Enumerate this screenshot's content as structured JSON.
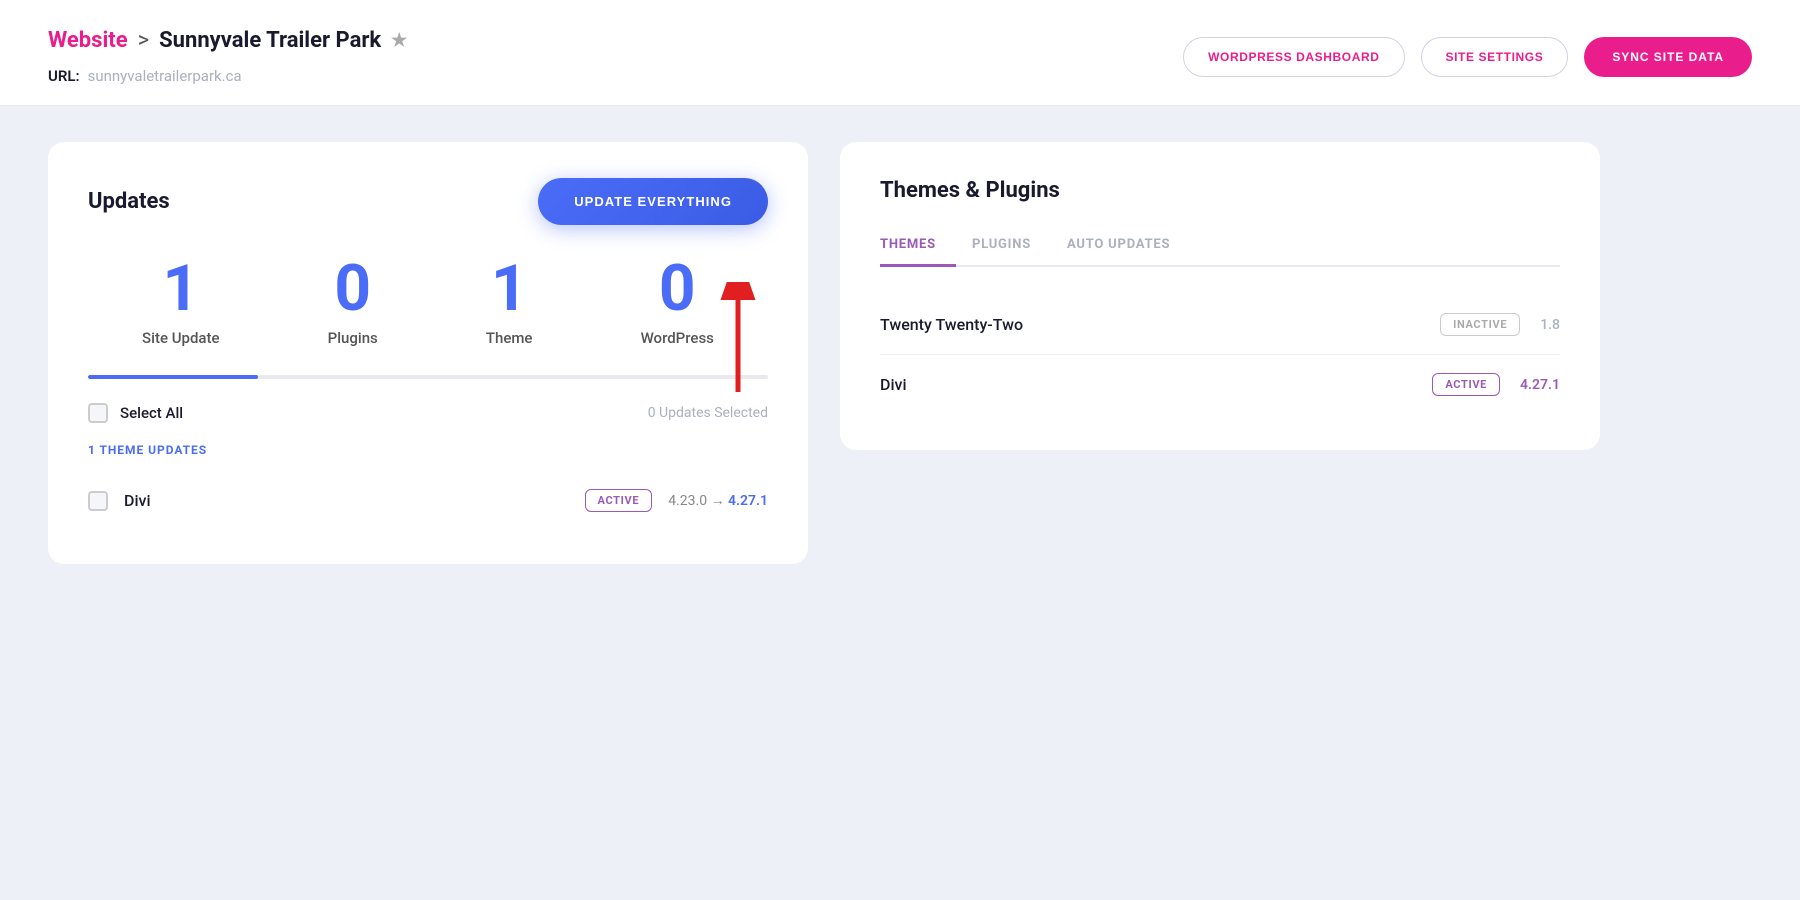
{
  "header": {
    "breadcrumb_link": "Website",
    "breadcrumb_sep": ">",
    "site_name": "Sunnyvale Trailer Park",
    "url_label": "URL:",
    "url_value": "sunnyvaletrailerpark.ca",
    "btn_wordpress_dashboard": "WORDPRESS DASHBOARD",
    "btn_site_settings": "SITE SETTINGS",
    "btn_sync_site_data": "SYNC SITE DATA"
  },
  "updates": {
    "title": "Updates",
    "btn_update_everything": "UPDATE EVERYTHING",
    "stats": [
      {
        "number": "1",
        "label": "Site Update"
      },
      {
        "number": "0",
        "label": "Plugins"
      },
      {
        "number": "1",
        "label": "Theme"
      },
      {
        "number": "0",
        "label": "WordPress"
      }
    ],
    "select_all_label": "Select All",
    "updates_selected_text": "0 Updates Selected",
    "section_label": "1 THEME UPDATES",
    "items": [
      {
        "name": "Divi",
        "badge": "ACTIVE",
        "version_from": "4.23.0",
        "arrow": "→",
        "version_to": "4.27.1"
      }
    ]
  },
  "themes_plugins": {
    "title": "Themes & Plugins",
    "tabs": [
      {
        "label": "THEMES",
        "active": true
      },
      {
        "label": "PLUGINS",
        "active": false
      },
      {
        "label": "AUTO UPDATES",
        "active": false
      }
    ],
    "themes": [
      {
        "name": "Twenty Twenty-Two",
        "badge": "INACTIVE",
        "version": "1.8"
      },
      {
        "name": "Divi",
        "badge": "ACTIVE",
        "version": "4.27.1"
      }
    ]
  },
  "colors": {
    "pink": "#e91e8c",
    "blue": "#4a6cf7",
    "purple": "#9b59b6",
    "inactive_badge": "#aaa"
  }
}
